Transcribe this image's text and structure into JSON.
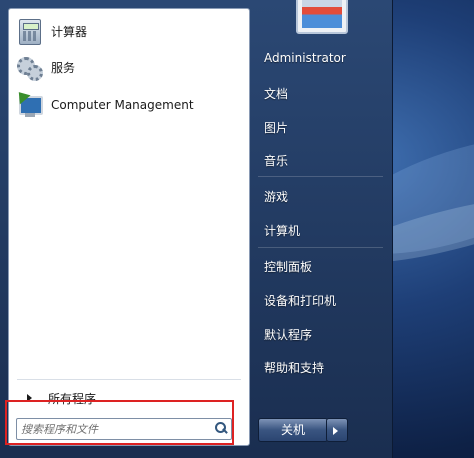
{
  "left_panel": {
    "programs": [
      {
        "label": "计算器",
        "icon": "calculator-icon"
      },
      {
        "label": "服务",
        "icon": "services-gears-icon"
      },
      {
        "label": "Computer Management",
        "icon": "computer-management-icon"
      }
    ],
    "all_programs_label": "所有程序",
    "search": {
      "placeholder": "搜索程序和文件",
      "value": ""
    }
  },
  "right_panel": {
    "user_name": "Administrator",
    "links": [
      "文档",
      "图片",
      "音乐",
      "游戏",
      "计算机",
      "控制面板",
      "设备和打印机",
      "默认程序",
      "帮助和支持"
    ],
    "shutdown_label": "关机"
  },
  "colors": {
    "highlight_border": "#dd2222",
    "menu_frame": "#243d66"
  }
}
